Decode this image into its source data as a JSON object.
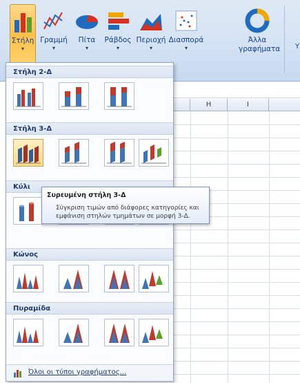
{
  "ribbon": {
    "buttons": [
      {
        "label": "Στήλη",
        "icon": "column-chart-icon",
        "dropdown": true
      },
      {
        "label": "Γραμμή",
        "icon": "line-chart-icon",
        "dropdown": true
      },
      {
        "label": "Πίτα",
        "icon": "pie-chart-icon",
        "dropdown": true
      },
      {
        "label": "Ράβδος",
        "icon": "bar-chart-icon",
        "dropdown": true
      },
      {
        "label": "Περιοχή",
        "icon": "area-chart-icon",
        "dropdown": true
      },
      {
        "label": "Διασπορά",
        "icon": "scatter-chart-icon",
        "dropdown": true
      },
      {
        "label": "Άλλα\nγραφήματα",
        "icon": "other-charts-icon",
        "dropdown": true
      }
    ],
    "more_label": "Y"
  },
  "sheet": {
    "columns": [
      "",
      "H",
      "I",
      ""
    ]
  },
  "gallery": {
    "sections": [
      {
        "title": "Στήλη 2-Δ"
      },
      {
        "title": "Στήλη 3-Δ"
      },
      {
        "title": "Κύλι"
      },
      {
        "title": "Κώνος"
      },
      {
        "title": "Πυραμίδα"
      }
    ],
    "footer_label": "Όλοι οι τύποι γραφήματος..."
  },
  "tooltip": {
    "title": "Συρευμένη στήλη 3-Δ",
    "description": "Σύγκριση τιμών από διάφορες κατηγορίες και εμφάνιση στηλών τμημάτων σε μορφή 3-Δ."
  },
  "colors": {
    "accent": "#ffc04a",
    "ribbon": "#d4e3f4",
    "header_text": "#15428b"
  }
}
